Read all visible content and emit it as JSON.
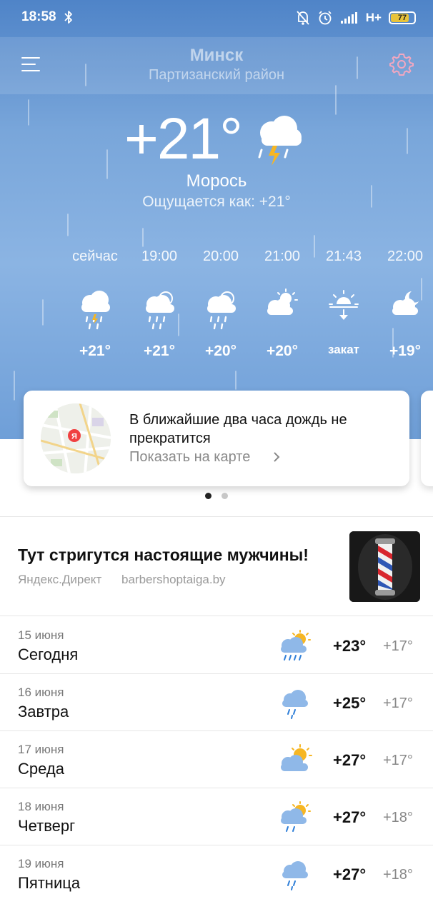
{
  "status_bar": {
    "time": "18:58",
    "network": "H+",
    "battery_percent": "77",
    "battery_level": 0.77
  },
  "location": {
    "city": "Минск",
    "district": "Партизанский район"
  },
  "current": {
    "temperature": "+21°",
    "condition": "Морось",
    "feels_like": "Ощущается как: +21°",
    "icon": "thunder-rain-cloud-icon"
  },
  "hourly": [
    {
      "time": "сейчас",
      "temp": "+21°",
      "icon": "rain-cloud-icon"
    },
    {
      "time": "19:00",
      "temp": "+21°",
      "icon": "sun-cloud-rain-icon"
    },
    {
      "time": "20:00",
      "temp": "+20°",
      "icon": "sun-cloud-rain-icon"
    },
    {
      "time": "21:00",
      "temp": "+20°",
      "icon": "sun-cloud-icon"
    },
    {
      "time": "21:43",
      "temp": "закат",
      "icon": "sunset-icon"
    },
    {
      "time": "22:00",
      "temp": "+19°",
      "icon": "moon-cloud-icon"
    }
  ],
  "nowcast": {
    "message": "В ближайшие два часа дождь не прекратится",
    "link": "Показать на карте",
    "map_marker": "Я"
  },
  "ad": {
    "title": "Тут стригутся настоящие мужчины!",
    "source": "Яндекс.Директ",
    "domain": "barbershoptaiga.by"
  },
  "daily": [
    {
      "date": "15 июня",
      "day": "Сегодня",
      "high": "+23°",
      "low": "+17°",
      "icon": "sun-cloud-rain-icon"
    },
    {
      "date": "16 июня",
      "day": "Завтра",
      "high": "+25°",
      "low": "+17°",
      "icon": "rain-cloud-icon"
    },
    {
      "date": "17 июня",
      "day": "Среда",
      "high": "+27°",
      "low": "+17°",
      "icon": "sun-cloud-icon"
    },
    {
      "date": "18 июня",
      "day": "Четверг",
      "high": "+27°",
      "low": "+18°",
      "icon": "sun-cloud-rain-icon"
    },
    {
      "date": "19 июня",
      "day": "Пятница",
      "high": "+27°",
      "low": "+18°",
      "icon": "rain-cloud-icon"
    }
  ],
  "colors": {
    "sky_top": "#4f84c8",
    "sky_bottom": "#6f9fd8",
    "sun": "#f6b623",
    "cloud_day": "#8fb8e8",
    "text_muted": "#888888"
  }
}
